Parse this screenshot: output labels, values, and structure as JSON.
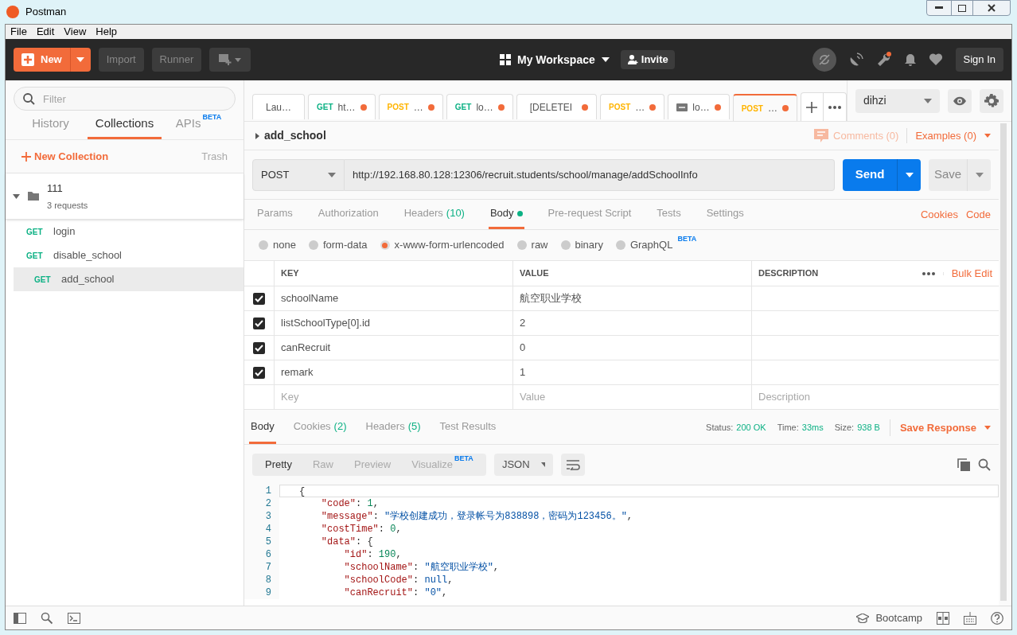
{
  "window": {
    "title": "Postman"
  },
  "menu": [
    "File",
    "Edit",
    "View",
    "Help"
  ],
  "header": {
    "new": "New",
    "import": "Import",
    "runner": "Runner",
    "workspace": "My Workspace",
    "invite": "Invite",
    "sign_in": "Sign In"
  },
  "sidebar": {
    "filter_placeholder": "Filter",
    "tabs": [
      {
        "label": "History",
        "selected": false
      },
      {
        "label": "Collections",
        "selected": true
      },
      {
        "label": "APIs",
        "selected": false,
        "badge": "BETA"
      }
    ],
    "new_collection": "New Collection",
    "trash": "Trash",
    "collections": [
      {
        "name": "111",
        "count": "3 requests",
        "expanded": true,
        "children": [
          {
            "method": "GET",
            "name": "login",
            "selected": false
          },
          {
            "method": "GET",
            "name": "disable_school",
            "selected": false
          },
          {
            "method": "GET",
            "name": "add_school",
            "selected": true
          }
        ]
      }
    ]
  },
  "request_tabs": [
    {
      "kind": "plain",
      "label": "Lau…",
      "unsaved": false,
      "selected": false
    },
    {
      "kind": "method",
      "method": "GET",
      "label": "ht…",
      "unsaved": true,
      "selected": false
    },
    {
      "kind": "method",
      "method": "POST",
      "label": "…",
      "unsaved": true,
      "selected": false
    },
    {
      "kind": "method",
      "method": "GET",
      "label": "lo…",
      "unsaved": true,
      "selected": false
    },
    {
      "kind": "plain",
      "label": "[DELETEI",
      "unsaved": true,
      "selected": false
    },
    {
      "kind": "method",
      "method": "POST",
      "label": "…",
      "unsaved": true,
      "selected": false
    },
    {
      "kind": "example",
      "label": "lo…",
      "unsaved": true,
      "selected": false
    },
    {
      "kind": "method",
      "method": "POST",
      "label": "…",
      "unsaved": true,
      "selected": true
    }
  ],
  "environment": "dihzi",
  "request": {
    "name": "add_school",
    "comments": "Comments (0)",
    "examples": "Examples (0)",
    "method": "POST",
    "url": "http://192.168.80.128:12306/recruit.students/school/manage/addSchoolInfo",
    "send": "Send",
    "save": "Save",
    "tabs": [
      {
        "label": "Params",
        "selected": false
      },
      {
        "label": "Authorization",
        "selected": false
      },
      {
        "label": "Headers",
        "count": "(10)",
        "selected": false
      },
      {
        "label": "Body",
        "dot": true,
        "selected": true
      },
      {
        "label": "Pre-request Script",
        "selected": false
      },
      {
        "label": "Tests",
        "selected": false
      },
      {
        "label": "Settings",
        "selected": false
      }
    ],
    "links": [
      "Cookies",
      "Code"
    ],
    "body_types": [
      {
        "label": "none",
        "selected": false
      },
      {
        "label": "form-data",
        "selected": false
      },
      {
        "label": "x-www-form-urlencoded",
        "selected": true
      },
      {
        "label": "raw",
        "selected": false
      },
      {
        "label": "binary",
        "selected": false
      },
      {
        "label": "GraphQL",
        "badge": "BETA",
        "selected": false
      }
    ],
    "table": {
      "columns": [
        "KEY",
        "VALUE",
        "DESCRIPTION"
      ],
      "bulk_edit": "Bulk Edit",
      "rows": [
        {
          "checked": true,
          "key": "schoolName",
          "value": "航空职业学校"
        },
        {
          "checked": true,
          "key": "listSchoolType[0].id",
          "value": "2"
        },
        {
          "checked": true,
          "key": "canRecruit",
          "value": "0"
        },
        {
          "checked": true,
          "key": "remark",
          "value": "1"
        }
      ],
      "new_row": [
        {
          "placeholder": "Key"
        },
        {
          "placeholder": "Value"
        },
        {
          "placeholder": "Description"
        }
      ]
    }
  },
  "response": {
    "tabs": [
      {
        "label": "Body",
        "selected": true
      },
      {
        "label": "Cookies",
        "count": "(2)",
        "selected": false
      },
      {
        "label": "Headers",
        "count": "(5)",
        "selected": false
      },
      {
        "label": "Test Results",
        "selected": false
      }
    ],
    "status": [
      {
        "label": "Status:",
        "value": "200 OK"
      },
      {
        "label": "Time:",
        "value": "33ms"
      },
      {
        "label": "Size:",
        "value": "938 B"
      }
    ],
    "save_response": "Save Response",
    "views": [
      {
        "label": "Pretty",
        "selected": true
      },
      {
        "label": "Raw",
        "selected": false
      },
      {
        "label": "Preview",
        "selected": false
      },
      {
        "label": "Visualize",
        "badge": "BETA",
        "selected": false
      }
    ],
    "format": "JSON",
    "lines": [
      {
        "number": "1",
        "tokens": [
          {
            "kind": "punct",
            "text": "{"
          }
        ]
      },
      {
        "number": "2",
        "tokens": [
          {
            "kind": "key",
            "text": "    \"code\""
          },
          {
            "kind": "punct",
            "text": ": "
          },
          {
            "kind": "num",
            "text": "1"
          },
          {
            "kind": "punct",
            "text": ","
          }
        ]
      },
      {
        "number": "3",
        "tokens": [
          {
            "kind": "key",
            "text": "    \"message\""
          },
          {
            "kind": "punct",
            "text": ": "
          },
          {
            "kind": "str",
            "text": "\"学校创建成功，登录帐号为838898，密码为123456。\""
          },
          {
            "kind": "punct",
            "text": ","
          }
        ]
      },
      {
        "number": "4",
        "tokens": [
          {
            "kind": "key",
            "text": "    \"costTime\""
          },
          {
            "kind": "punct",
            "text": ": "
          },
          {
            "kind": "num",
            "text": "0"
          },
          {
            "kind": "punct",
            "text": ","
          }
        ]
      },
      {
        "number": "5",
        "tokens": [
          {
            "kind": "key",
            "text": "    \"data\""
          },
          {
            "kind": "punct",
            "text": ": {"
          }
        ]
      },
      {
        "number": "6",
        "tokens": [
          {
            "kind": "key",
            "text": "        \"id\""
          },
          {
            "kind": "punct",
            "text": ": "
          },
          {
            "kind": "num",
            "text": "190"
          },
          {
            "kind": "punct",
            "text": ","
          }
        ]
      },
      {
        "number": "7",
        "tokens": [
          {
            "kind": "key",
            "text": "        \"schoolName\""
          },
          {
            "kind": "punct",
            "text": ": "
          },
          {
            "kind": "str",
            "text": "\"航空职业学校\""
          },
          {
            "kind": "punct",
            "text": ","
          }
        ]
      },
      {
        "number": "8",
        "tokens": [
          {
            "kind": "key",
            "text": "        \"schoolCode\""
          },
          {
            "kind": "punct",
            "text": ": "
          },
          {
            "kind": "null",
            "text": "null"
          },
          {
            "kind": "punct",
            "text": ","
          }
        ]
      },
      {
        "number": "9",
        "tokens": [
          {
            "kind": "key",
            "text": "        \"canRecruit\""
          },
          {
            "kind": "punct",
            "text": ": "
          },
          {
            "kind": "str",
            "text": "\"0\""
          },
          {
            "kind": "punct",
            "text": ","
          }
        ]
      }
    ]
  },
  "footer": {
    "bootcamp": "Bootcamp"
  }
}
